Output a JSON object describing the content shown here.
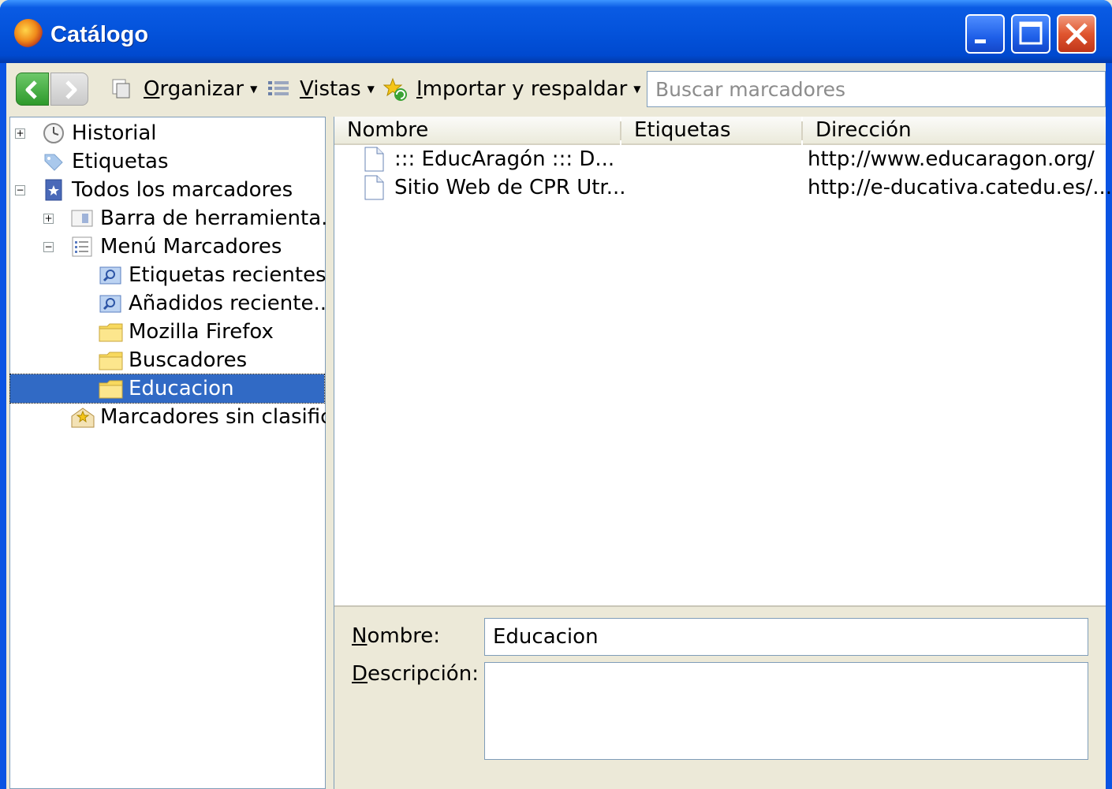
{
  "window": {
    "title": "Catálogo",
    "accent": "#0A54E3",
    "close_color": "#E0552F"
  },
  "toolbar": {
    "back_icon": "arrow-left-icon",
    "forward_icon": "arrow-right-icon",
    "organize_accesskey": "O",
    "organize_rest": "rganizar",
    "views_accesskey": "V",
    "views_rest": "istas",
    "import_accesskey": "I",
    "import_rest": "mportar y respaldar",
    "search_placeholder": "Buscar marcadores",
    "search_value": ""
  },
  "tree": [
    {
      "label": "Historial",
      "icon": "clock-icon",
      "expander": "+"
    },
    {
      "label": "Etiquetas",
      "icon": "tag-icon",
      "expander": ""
    },
    {
      "label": "Todos los marcadores",
      "icon": "bookmarks-star-icon",
      "expander": "−"
    },
    {
      "label": "Barra de herramienta...",
      "icon": "toolbar-icon",
      "expander": "+"
    },
    {
      "label": "Menú Marcadores",
      "icon": "menu-list-icon",
      "expander": "−"
    },
    {
      "label": "Etiquetas recientes",
      "icon": "smart-folder-icon",
      "expander": ""
    },
    {
      "label": "Añadidos reciente...",
      "icon": "smart-folder-icon",
      "expander": ""
    },
    {
      "label": "Mozilla Firefox",
      "icon": "folder-icon",
      "expander": ""
    },
    {
      "label": "Buscadores",
      "icon": "folder-icon",
      "expander": ""
    },
    {
      "label": "Educacion",
      "icon": "folder-icon",
      "expander": "",
      "selected": true
    },
    {
      "label": "Marcadores sin clasificar",
      "icon": "unsorted-bookmarks-icon",
      "expander": ""
    }
  ],
  "list": {
    "columns": [
      "Nombre",
      "Etiquetas",
      "Dirección"
    ],
    "rows": [
      {
        "name": "::: EducAragón ::: D...",
        "tags": "",
        "url": "http://www.educaragon.org/"
      },
      {
        "name": "Sitio Web de CPR Utr...",
        "tags": "",
        "url": "http://e-ducativa.catedu.es/..."
      }
    ]
  },
  "details": {
    "name_accesskey": "N",
    "name_rest": "ombre:",
    "name_value": "Educacion",
    "desc_accesskey": "D",
    "desc_rest": "escripción:",
    "desc_value": ""
  },
  "colors": {
    "selection": "#316AC5",
    "field_border": "#7F9DB9"
  }
}
